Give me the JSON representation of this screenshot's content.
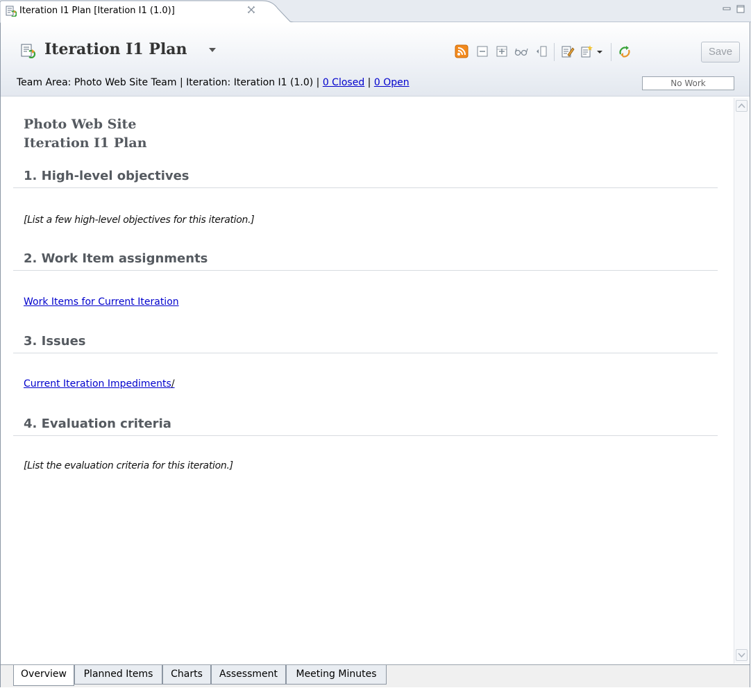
{
  "editor_tab": {
    "title": "Iteration I1 Plan [Iteration I1 (1.0)]",
    "icon": "plan-refresh-icon"
  },
  "header": {
    "plan_title": "Iteration I1 Plan",
    "info": {
      "team_area": "Team Area: Photo Web Site Team | Iteration: Iteration I1 (1.0) | ",
      "closed_link": "0 Closed",
      "separator": " | ",
      "open_link": "0 Open"
    },
    "progress_label": "No Work",
    "save_label": "Save",
    "toolbar_icons": [
      "rss-feed-icon",
      "collapse-all-icon",
      "expand-all-icon",
      "glasses-icon",
      "side-panel-icon",
      "edit-page-icon",
      "new-page-icon",
      "dropdown-arrow-icon",
      "refresh-icon"
    ]
  },
  "document": {
    "heading_line1": "Photo Web Site",
    "heading_line2": "Iteration I1 Plan",
    "sections": [
      {
        "title": "1. High-level objectives",
        "body": "[List a few high-level objectives for this iteration.]"
      },
      {
        "title": "2. Work Item assignments",
        "link": "Work Items for Current Iteration"
      },
      {
        "title": "3. Issues",
        "link": "Current Iteration Impediments",
        "suffix": "/"
      },
      {
        "title": "4. Evaluation criteria",
        "body": "[List the evaluation criteria for this iteration.]"
      }
    ]
  },
  "bottom_tabs": [
    "Overview",
    "Planned Items",
    "Charts",
    "Assessment",
    "Meeting Minutes"
  ],
  "colors": {
    "accent_link": "#0000cc",
    "rss_orange": "#f28a1e",
    "heading_gray": "#555a60"
  }
}
